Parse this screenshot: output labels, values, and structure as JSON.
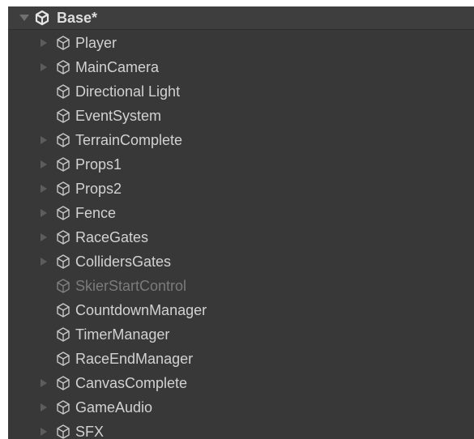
{
  "hierarchy": {
    "scene": {
      "label": "Base*",
      "icon": "unity-scene-icon",
      "expanded": true
    },
    "items": [
      {
        "label": "Player",
        "icon": "gameobject-cube-icon",
        "has_children": true,
        "active": true
      },
      {
        "label": "MainCamera",
        "icon": "gameobject-cube-icon",
        "has_children": true,
        "active": true
      },
      {
        "label": "Directional Light",
        "icon": "gameobject-cube-icon",
        "has_children": false,
        "active": true
      },
      {
        "label": "EventSystem",
        "icon": "gameobject-cube-icon",
        "has_children": false,
        "active": true
      },
      {
        "label": "TerrainComplete",
        "icon": "gameobject-cube-icon",
        "has_children": true,
        "active": true
      },
      {
        "label": "Props1",
        "icon": "gameobject-cube-icon",
        "has_children": true,
        "active": true
      },
      {
        "label": "Props2",
        "icon": "gameobject-cube-icon",
        "has_children": true,
        "active": true
      },
      {
        "label": "Fence",
        "icon": "gameobject-cube-icon",
        "has_children": true,
        "active": true
      },
      {
        "label": "RaceGates",
        "icon": "gameobject-cube-icon",
        "has_children": true,
        "active": true
      },
      {
        "label": "CollidersGates",
        "icon": "gameobject-cube-icon",
        "has_children": true,
        "active": true
      },
      {
        "label": "SkierStartControl",
        "icon": "gameobject-cube-icon",
        "has_children": false,
        "active": false
      },
      {
        "label": "CountdownManager",
        "icon": "gameobject-cube-icon",
        "has_children": false,
        "active": true
      },
      {
        "label": "TimerManager",
        "icon": "gameobject-cube-icon",
        "has_children": false,
        "active": true
      },
      {
        "label": "RaceEndManager",
        "icon": "gameobject-cube-icon",
        "has_children": false,
        "active": true
      },
      {
        "label": "CanvasComplete",
        "icon": "gameobject-cube-icon",
        "has_children": true,
        "active": true
      },
      {
        "label": "GameAudio",
        "icon": "gameobject-cube-icon",
        "has_children": true,
        "active": true
      },
      {
        "label": "SFX",
        "icon": "gameobject-cube-icon",
        "has_children": true,
        "active": true
      }
    ]
  },
  "colors": {
    "panel_background": "#383838",
    "text": "#d2d2d2",
    "inactive_text": "#7b7b7b",
    "arrow": "#5d5d5d"
  }
}
